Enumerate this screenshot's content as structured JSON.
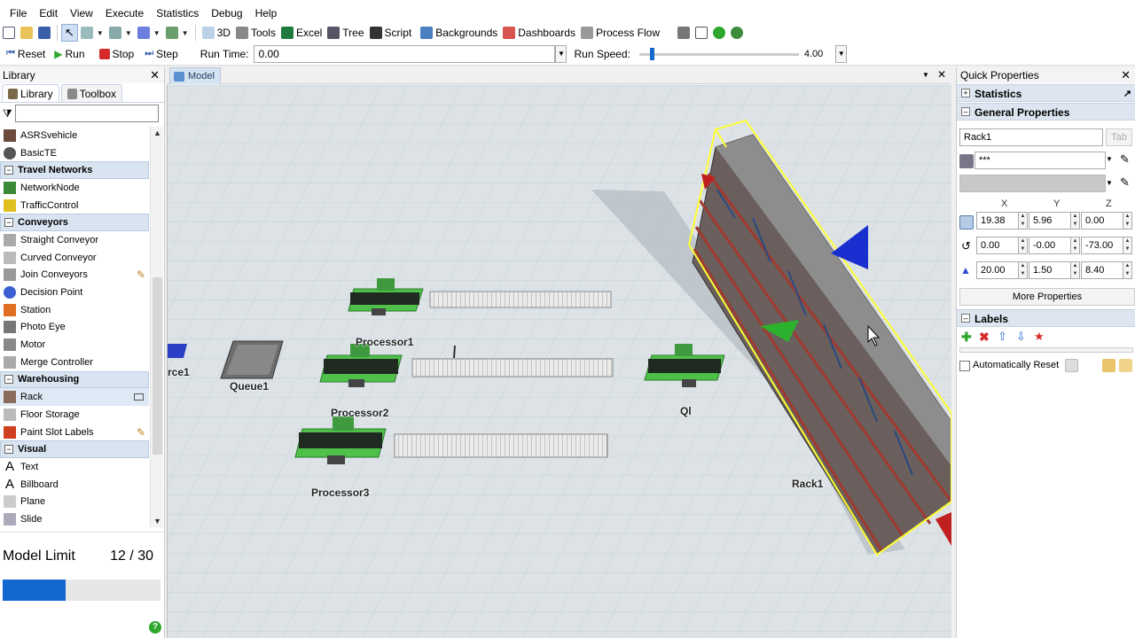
{
  "menu": [
    "File",
    "Edit",
    "View",
    "Execute",
    "Statistics",
    "Debug",
    "Help"
  ],
  "toolbar": {
    "btn_3d": "3D",
    "tools": "Tools",
    "excel": "Excel",
    "tree": "Tree",
    "script": "Script",
    "backgrounds": "Backgrounds",
    "dashboards": "Dashboards",
    "process_flow": "Process Flow"
  },
  "runbar": {
    "reset": "Reset",
    "run": "Run",
    "stop": "Stop",
    "step": "Step",
    "run_time_label": "Run Time:",
    "run_time_value": "0.00",
    "run_speed_label": "Run Speed:",
    "run_speed_value": "4.00",
    "run_speed_fraction": 0.07
  },
  "library": {
    "title": "Library",
    "tab_library": "Library",
    "tab_toolbox": "Toolbox",
    "filter_value": "",
    "items": [
      {
        "type": "item",
        "label": "ASRSvehicle",
        "icon": "asrs-vehicle-icon"
      },
      {
        "type": "item",
        "label": "BasicTE",
        "icon": "basic-te-icon"
      },
      {
        "type": "cat",
        "label": "Travel Networks"
      },
      {
        "type": "item",
        "label": "NetworkNode",
        "icon": "network-node-icon"
      },
      {
        "type": "item",
        "label": "TrafficControl",
        "icon": "traffic-control-icon"
      },
      {
        "type": "cat",
        "label": "Conveyors"
      },
      {
        "type": "item",
        "label": "Straight Conveyor",
        "icon": "straight-conveyor-icon"
      },
      {
        "type": "item",
        "label": "Curved Conveyor",
        "icon": "curved-conveyor-icon"
      },
      {
        "type": "item",
        "label": "Join Conveyors",
        "icon": "join-conveyors-icon",
        "pencil": true
      },
      {
        "type": "item",
        "label": "Decision Point",
        "icon": "decision-point-icon"
      },
      {
        "type": "item",
        "label": "Station",
        "icon": "station-icon"
      },
      {
        "type": "item",
        "label": "Photo Eye",
        "icon": "photo-eye-icon"
      },
      {
        "type": "item",
        "label": "Motor",
        "icon": "motor-icon"
      },
      {
        "type": "item",
        "label": "Merge Controller",
        "icon": "merge-controller-icon"
      },
      {
        "type": "cat",
        "label": "Warehousing"
      },
      {
        "type": "item",
        "label": "Rack",
        "icon": "rack-icon",
        "selected": true
      },
      {
        "type": "item",
        "label": "Floor Storage",
        "icon": "floor-storage-icon"
      },
      {
        "type": "item",
        "label": "Paint Slot Labels",
        "icon": "paint-slot-labels-icon",
        "pencil": true
      },
      {
        "type": "cat",
        "label": "Visual"
      },
      {
        "type": "item",
        "label": "Text",
        "icon": "text-icon"
      },
      {
        "type": "item",
        "label": "Billboard",
        "icon": "billboard-icon"
      },
      {
        "type": "item",
        "label": "Plane",
        "icon": "plane-icon"
      },
      {
        "type": "item",
        "label": "Slide",
        "icon": "slide-icon"
      }
    ]
  },
  "model_limit": {
    "label": "Model Limit",
    "count": "12 / 30",
    "used": 12,
    "max": 30
  },
  "model_tab": {
    "label": "Model"
  },
  "objects": {
    "source": "rce1",
    "queue": "Queue1",
    "p1": "Processor1",
    "p2": "Processor2",
    "p3": "Processor3",
    "ql": "Ql",
    "rack": "Rack1"
  },
  "quick": {
    "title": "Quick Properties",
    "statistics": "Statistics",
    "general": "General Properties",
    "name": "Rack1",
    "visual": "***",
    "x": "X",
    "y": "Y",
    "z": "Z",
    "pos": [
      "19.38",
      "5.96",
      "0.00"
    ],
    "rot": [
      "0.00",
      "-0.00",
      "-73.00"
    ],
    "size": [
      "20.00",
      "1.50",
      "8.40"
    ],
    "more": "More Properties",
    "labels": "Labels",
    "auto_reset": "Automatically Reset"
  },
  "colors": {
    "accent": "#1567d0",
    "selection": "#ffff33",
    "processor_green": "#4fc04a"
  }
}
